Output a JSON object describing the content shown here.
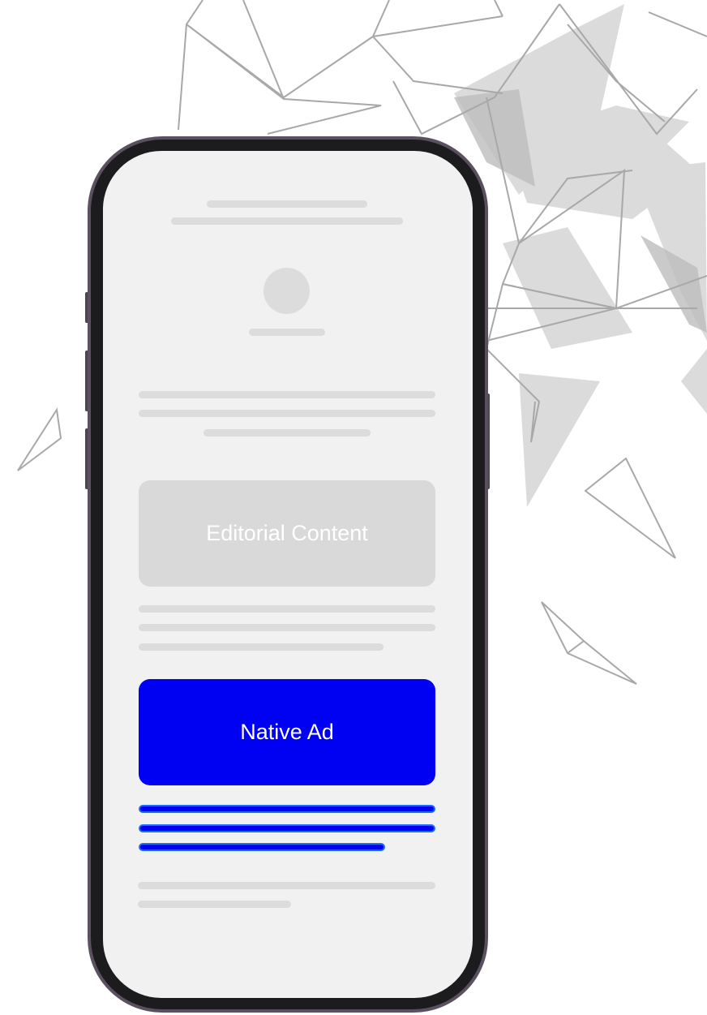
{
  "blocks": {
    "editorial_label": "Editorial Content",
    "native_ad_label": "Native Ad"
  },
  "colors": {
    "native_ad": "#0000f2",
    "native_text_lines": "#0000f0",
    "placeholder": "#dcdcdc",
    "screen": "#f1f1f1",
    "phone_frame": "#5b5060"
  }
}
